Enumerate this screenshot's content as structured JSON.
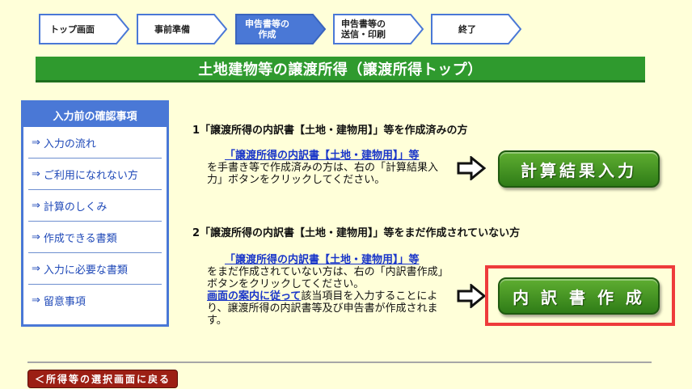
{
  "steps": [
    {
      "line1": "トップ画面",
      "line2": "",
      "active": false
    },
    {
      "line1": "事前準備",
      "line2": "",
      "active": false
    },
    {
      "line1": "申告書等の",
      "line2": "作成",
      "active": true
    },
    {
      "line1": "申告書等の",
      "line2": "送信・印刷",
      "active": false
    },
    {
      "line1": "終了",
      "line2": "",
      "active": false
    }
  ],
  "page_title": "土地建物等の譲渡所得（譲渡所得トップ）",
  "sidebar": {
    "heading": "入力前の確認事項",
    "arrow": "⇒",
    "items": [
      {
        "label": "入力の流れ"
      },
      {
        "label": "ご利用になれない方"
      },
      {
        "label": "計算のしくみ"
      },
      {
        "label": "作成できる書類"
      },
      {
        "label": "入力に必要な書類"
      },
      {
        "label": "留意事項"
      }
    ]
  },
  "section1": {
    "title": "1「譲渡所得の内訳書【土地・建物用】」等を作成済みの方",
    "link": "「譲渡所得の内訳書【土地・建物用】」等",
    "text": "を手書き等で作成済みの方は、右の「計算結果入力」ボタンをクリックしてください。",
    "button": "計算結果入力"
  },
  "section2": {
    "title": "2「譲渡所得の内訳書【土地・建物用】」等をまだ作成されていない方",
    "link": "「譲渡所得の内訳書【土地・建物用】」等",
    "text": "をまだ作成されていない方は、右の「内訳書作成」ボタンをクリックしてください。",
    "link2": "画面の案内に従って",
    "text2": "該当項目を入力することにより、譲渡所得の内訳書等及び申告書が作成されます。",
    "button": "内 訳 書 作 成"
  },
  "footer": {
    "back_button": "＜所得等の選択画面に戻る"
  },
  "colors": {
    "background": "#ffffd9",
    "title_bar": "#2f9a2e",
    "step_active": "#4a78d6",
    "sidebar_border": "#4a78d6",
    "button_green": "#2f7c17",
    "highlight": "#ee3b3b",
    "back_button": "#9c1f14"
  }
}
